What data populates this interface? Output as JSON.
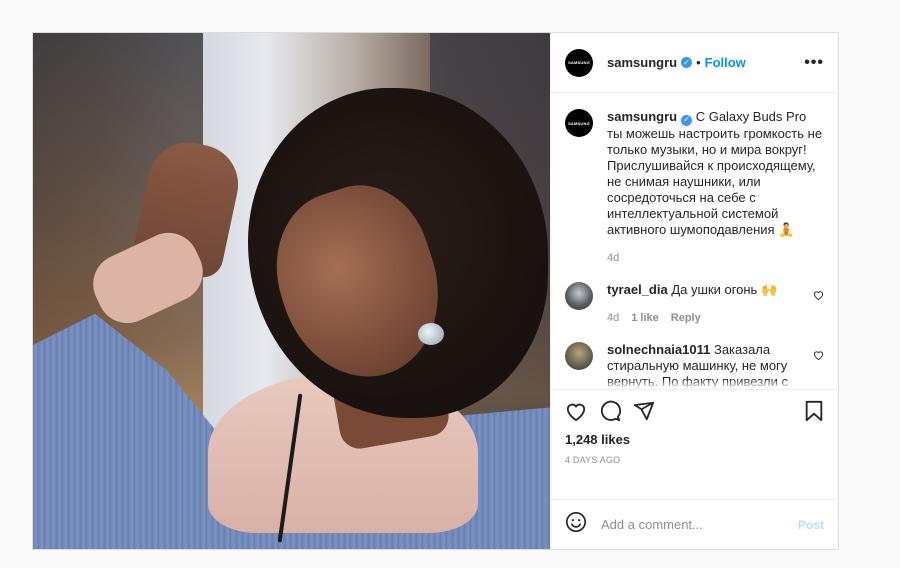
{
  "post": {
    "username": "samsungru",
    "avatar_text": "SAMSUNG",
    "follow_label": "Follow",
    "more_label": "•••",
    "caption": "С Galaxy Buds Pro ты можешь настроить громкость не только музыки, но и мира вокруг! Прислушивайся к происходящему, не снимая наушники, или сосредоточься на себе с интеллектуальной системой активного шумоподавления 🧘",
    "caption_age": "4d",
    "likes": "1,248 likes",
    "date": "4 DAYS AGO"
  },
  "comments": [
    {
      "username": "tyrael_dia",
      "text": "Да ушки огонь 🙌",
      "age": "4d",
      "likes": "1 like",
      "reply": "Reply"
    },
    {
      "username": "solnechnaia1011",
      "text": "Заказала стиральную машинку, не могу вернуть. По факту привезли с браком. Позор Самсунг, и это официальный сайт"
    }
  ],
  "add_comment": {
    "emoji_icon": "☺",
    "placeholder": "Add a comment...",
    "post_label": "Post"
  },
  "colors": {
    "accent": "#0095f6",
    "verified": "#3897f0",
    "post_disabled": "#b2dffc"
  },
  "icons": [
    "heart-icon",
    "comment-icon",
    "share-icon",
    "bookmark-icon",
    "verified-icon",
    "smiley-icon"
  ]
}
